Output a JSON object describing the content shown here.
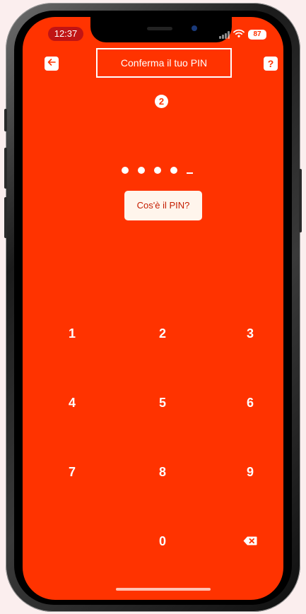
{
  "status_bar": {
    "time": "12:37",
    "battery": "87"
  },
  "header": {
    "title": "Conferma il tuo PIN",
    "help_label": "?",
    "step_number": "2"
  },
  "pin": {
    "digits_entered": 4,
    "what_is_pin_label": "Cos'è il PIN?"
  },
  "keypad": {
    "keys": [
      "1",
      "2",
      "3",
      "4",
      "5",
      "6",
      "7",
      "8",
      "9",
      "0"
    ]
  },
  "colors": {
    "background": "#ff3300",
    "accent_text": "#c41d00",
    "button_bg": "#fff5ec"
  }
}
